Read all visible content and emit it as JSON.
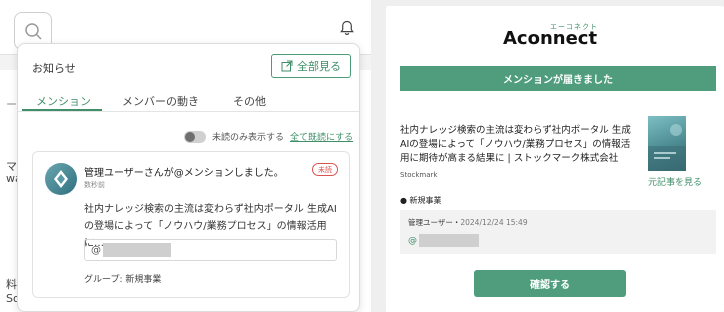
{
  "left_panel": {
    "background_snippets": [
      "ー",
      "マ",
      "wa",
      "料",
      "So"
    ],
    "notifications": {
      "title": "お知らせ",
      "view_all_label": "全部見る",
      "tabs": [
        {
          "label": "メンション",
          "active": true
        },
        {
          "label": "メンバーの動き",
          "active": false
        },
        {
          "label": "その他",
          "active": false
        }
      ],
      "unread_only_label": "未読のみ表示する",
      "mark_all_read_label": "全て既読にする",
      "item": {
        "title": "管理ユーザーさんが@メンションしました。",
        "time": "数秒前",
        "badge": "未読",
        "body": "社内ナレッジ検索の主流は変わらず社内ポータル 生成AIの登場によって「ノウハウ/業務プロセス」の情報活用に…",
        "mention_prefix": "@",
        "group": "グループ: 新規事業"
      }
    }
  },
  "right_panel": {
    "logo_kana": "エーコネクト",
    "logo_text": "Aconnect",
    "banner": "メンションが届きました",
    "article": {
      "title": "社内ナレッジ検索の主流は変わらず社内ポータル 生成AIの登場によって「ノウハウ/業務プロセス」の情報活用に期待が高まる結果に | ストックマーク株式会社",
      "source": "Stockmark",
      "original_link": "元記事を見る"
    },
    "group_label": "● 新規事業",
    "comment": {
      "author": "管理ユーザー",
      "separator": "・",
      "time": "2024/12/24 15:49",
      "mention_prefix": "@"
    },
    "confirm_label": "確認する"
  },
  "colors": {
    "accent": "#4f9d7d",
    "accent_text": "#3f8f69",
    "unread": "#d9534f"
  }
}
